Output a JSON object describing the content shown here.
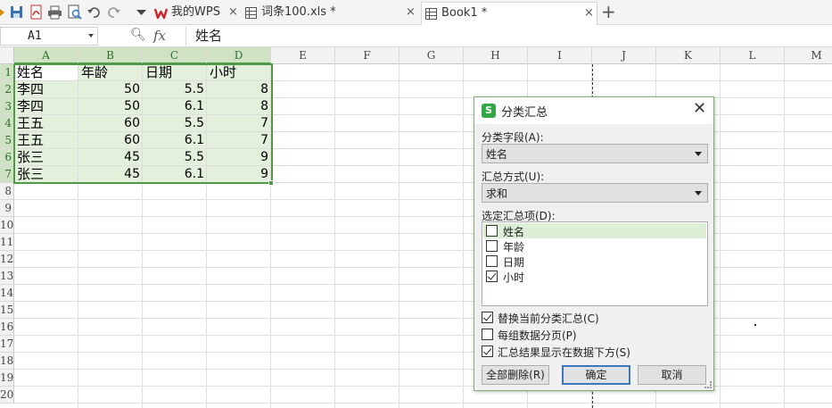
{
  "tabs": [
    {
      "label": "我的WPS",
      "close": "×"
    },
    {
      "label": "词条100.xls *",
      "close": "×"
    },
    {
      "label": "Book1 *",
      "close": "×"
    }
  ],
  "tab_add": "+",
  "formula_bar": {
    "name_box": "A1",
    "fx": "fx",
    "content": "姓名"
  },
  "columns": [
    "A",
    "B",
    "C",
    "D",
    "E",
    "F",
    "G",
    "H",
    "I",
    "J",
    "K",
    "L",
    "M"
  ],
  "rows": [
    "1",
    "2",
    "3",
    "4",
    "5",
    "6",
    "7",
    "8",
    "9",
    "10",
    "11",
    "12",
    "13",
    "14",
    "15",
    "16",
    "17",
    "18",
    "19",
    "20"
  ],
  "table": {
    "header": [
      "姓名",
      "年龄",
      "日期",
      "小时"
    ],
    "rows": [
      [
        "李四",
        "50",
        "5.5",
        "8"
      ],
      [
        "李四",
        "50",
        "6.1",
        "8"
      ],
      [
        "王五",
        "60",
        "5.5",
        "7"
      ],
      [
        "王五",
        "60",
        "6.1",
        "7"
      ],
      [
        "张三",
        "45",
        "5.5",
        "9"
      ],
      [
        "张三",
        "45",
        "6.1",
        "9"
      ]
    ]
  },
  "dialog": {
    "title": "分类汇总",
    "close": "✕",
    "group_field_label": "分类字段(A):",
    "group_field_value": "姓名",
    "summary_method_label": "汇总方式(U):",
    "summary_method_value": "求和",
    "items_label": "选定汇总项(D):",
    "items": [
      {
        "label": "姓名",
        "checked": false
      },
      {
        "label": "年龄",
        "checked": false
      },
      {
        "label": "日期",
        "checked": false
      },
      {
        "label": "小时",
        "checked": true
      }
    ],
    "options": [
      {
        "label": "替换当前分类汇总(C)",
        "checked": true
      },
      {
        "label": "每组数据分页(P)",
        "checked": false
      },
      {
        "label": "汇总结果显示在数据下方(S)",
        "checked": true
      }
    ],
    "buttons": {
      "delete_all": "全部删除(R)",
      "ok": "确定",
      "cancel": "取消"
    }
  },
  "colors": {
    "accent": "#4f9a46",
    "selection_fill": "#e3f1dc",
    "wps_red": "#d0232b"
  }
}
